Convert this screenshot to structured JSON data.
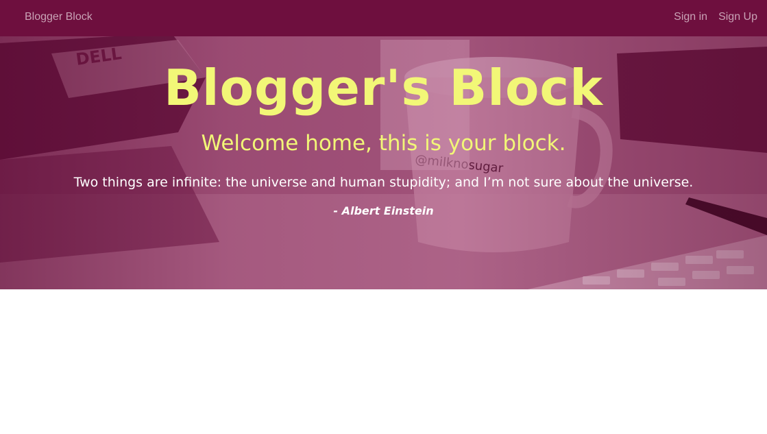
{
  "navbar": {
    "brand": "Blogger Block",
    "links": [
      "Sign in",
      "Sign Up"
    ],
    "background": "#6e0f3e"
  },
  "hero": {
    "title": "Blogger's Block",
    "subtitle": "Welcome home, this is your block.",
    "quote": "Two things are infinite: the universe and human stupidity; and I’m not sure about the universe.",
    "author": "- Albert Einstein",
    "background_image_lettering": [
      "DELL",
      "@milknosugar"
    ],
    "accent_color": "#f2f777"
  }
}
